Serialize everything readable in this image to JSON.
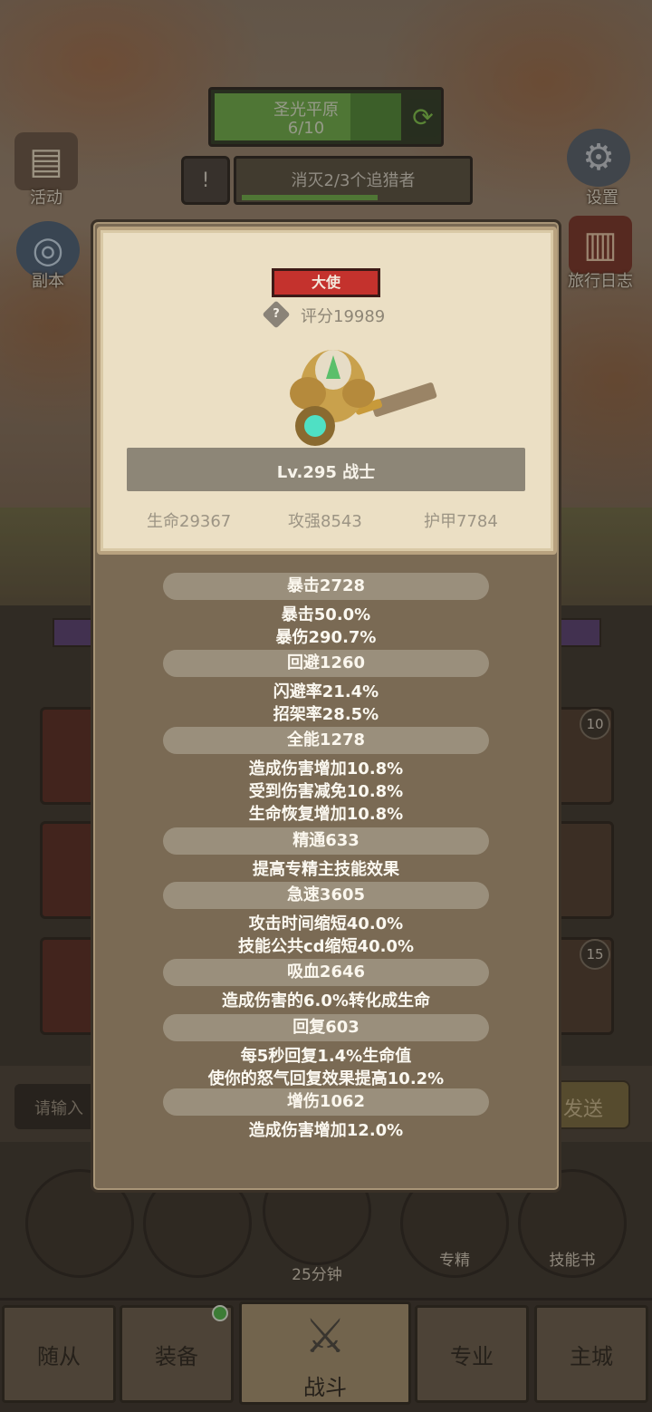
{
  "hud": {
    "zone_name": "圣光平原",
    "zone_progress": "6/10",
    "quest_text": "消灭2/3个追猎者",
    "side_left": [
      {
        "label": "活动",
        "icon": "scroll-icon"
      },
      {
        "label": "副本",
        "icon": "portal-icon"
      }
    ],
    "side_right": [
      {
        "label": "设置",
        "icon": "gear-icon"
      },
      {
        "label": "旅行日志",
        "icon": "journal-icon"
      }
    ]
  },
  "card": {
    "rank_badge": "大使",
    "score_label": "评分19989",
    "level_title": "Lv.295 战士",
    "hp": "生命29367",
    "attack": "攻强8543",
    "armor": "护甲7784"
  },
  "stats": [
    {
      "title": "暴击2728",
      "details": [
        "暴击50.0%",
        "暴伤290.7%"
      ]
    },
    {
      "title": "回避1260",
      "details": [
        "闪避率21.4%",
        "招架率28.5%"
      ]
    },
    {
      "title": "全能1278",
      "details": [
        "造成伤害增加10.8%",
        "受到伤害减免10.8%",
        "生命恢复增加10.8%"
      ]
    },
    {
      "title": "精通633",
      "details": [
        "提高专精主技能效果"
      ]
    },
    {
      "title": "急速3605",
      "details": [
        "攻击时间缩短40.0%",
        "技能公共cd缩短40.0%"
      ]
    },
    {
      "title": "吸血2646",
      "details": [
        "造成伤害的6.0%转化成生命"
      ]
    },
    {
      "title": "回复603",
      "details": [
        "每5秒回复1.4%生命值",
        "使你的怒气回复效果提高10.2%"
      ]
    },
    {
      "title": "增伤1062",
      "details": [
        "造成伤害增加12.0%"
      ]
    }
  ],
  "background": {
    "slot_badges": [
      "10",
      "15"
    ],
    "chat_placeholder": "请输入",
    "send_label": "发送",
    "timer_label": "25分钟",
    "round_labels": [
      "专精",
      "技能书"
    ]
  },
  "nav": {
    "tabs": [
      "随从",
      "装备",
      "战斗",
      "专业",
      "主城"
    ]
  },
  "colors": {
    "rank_badge": "#c4322d",
    "progress_green": "#6fae4a",
    "modal_bg": "#7a6a54",
    "card_bg": "#ebdfc4"
  }
}
